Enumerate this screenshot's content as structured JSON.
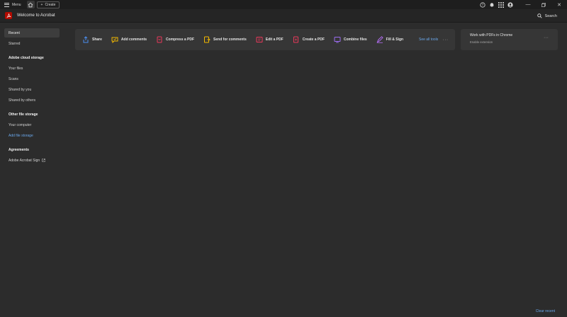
{
  "titlebar": {
    "menu_label": "Menu",
    "create_label": "Create",
    "icons": [
      "help-icon",
      "bell-icon",
      "apps-grid-icon",
      "profile-icon"
    ],
    "window_controls": [
      "minimize",
      "restore",
      "close"
    ]
  },
  "header": {
    "title": "Welcome to Acrobat",
    "search_label": "Search"
  },
  "sidebar": {
    "top_items": [
      {
        "label": "Recent",
        "active": true
      },
      {
        "label": "Starred",
        "active": false
      }
    ],
    "sections": [
      {
        "heading": "Adobe cloud storage",
        "items": [
          "Your files",
          "Scans",
          "Shared by you",
          "Shared by others"
        ]
      },
      {
        "heading": "Other file storage",
        "items": [
          "Your computer"
        ],
        "link": "Add file storage"
      },
      {
        "heading": "Agreements",
        "items": [
          "Adobe Acrobat Sign"
        ]
      }
    ]
  },
  "tools": {
    "items": [
      {
        "label": "Share",
        "icon": "share-icon",
        "color": "#4b8ef0"
      },
      {
        "label": "Add comments",
        "icon": "comment-icon",
        "color": "#f2b800"
      },
      {
        "label": "Compress a PDF",
        "icon": "compress-icon",
        "color": "#e8385a"
      },
      {
        "label": "Send for comments",
        "icon": "send-comments-icon",
        "color": "#f2b800"
      },
      {
        "label": "Edit a PDF",
        "icon": "edit-pdf-icon",
        "color": "#e8385a"
      },
      {
        "label": "Create a PDF",
        "icon": "create-pdf-icon",
        "color": "#e8385a"
      },
      {
        "label": "Combine files",
        "icon": "combine-icon",
        "color": "#9b6cf0"
      },
      {
        "label": "Fill & Sign",
        "icon": "fill-sign-icon",
        "color": "#b16cf0"
      }
    ],
    "see_all_label": "See all tools",
    "more_label": "···"
  },
  "chrome_card": {
    "title": "Work with PDFs in Chrome",
    "link": "Enable extension",
    "more_label": "···"
  },
  "footer": {
    "clear_recent": "Clear recent"
  },
  "colors": {
    "background": "#2c2c2c",
    "titlebar": "#1e1e1e",
    "panel": "#363636",
    "link": "#6aa7ea",
    "brand": "#b30b00"
  }
}
